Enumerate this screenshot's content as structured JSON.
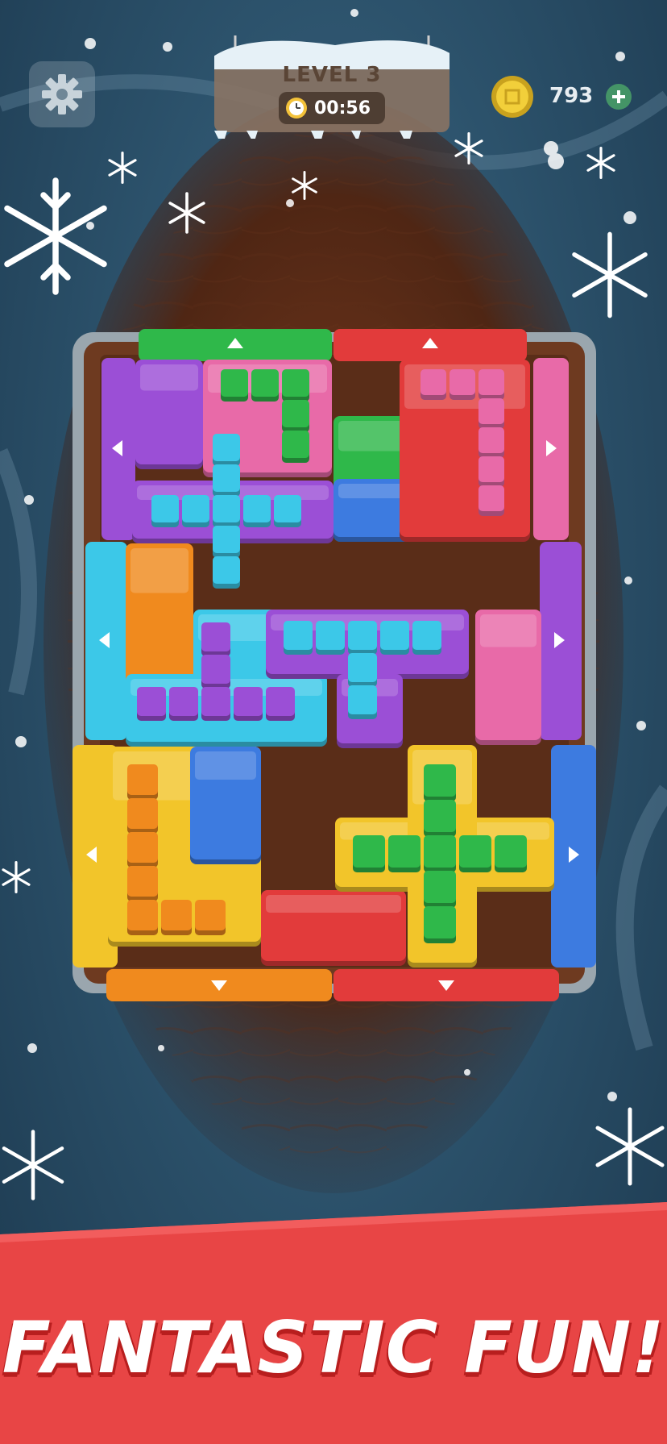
{
  "hud": {
    "level_label": "LEVEL 3",
    "timer": "00:56",
    "coins": "793",
    "settings_icon": "gear-icon",
    "timer_icon": "clock-icon",
    "coin_icon": "coin-icon",
    "add_coins_icon": "plus-icon"
  },
  "banner": {
    "text": "FANTASTIC FUN!",
    "color": "#e84545"
  },
  "board": {
    "block_colors": [
      "#9b4fd6",
      "#e86aa8",
      "#2fb84a",
      "#3aa0e0",
      "#f08a1e",
      "#f2c52a",
      "#e23b3b",
      "#3d7be0"
    ],
    "exit_gates": {
      "top": [
        "green",
        "red"
      ],
      "left": [
        "purple",
        "cyan",
        "yellow"
      ],
      "right": [
        "pink",
        "purple",
        "blue"
      ],
      "bottom": [
        "orange",
        "red"
      ]
    }
  }
}
